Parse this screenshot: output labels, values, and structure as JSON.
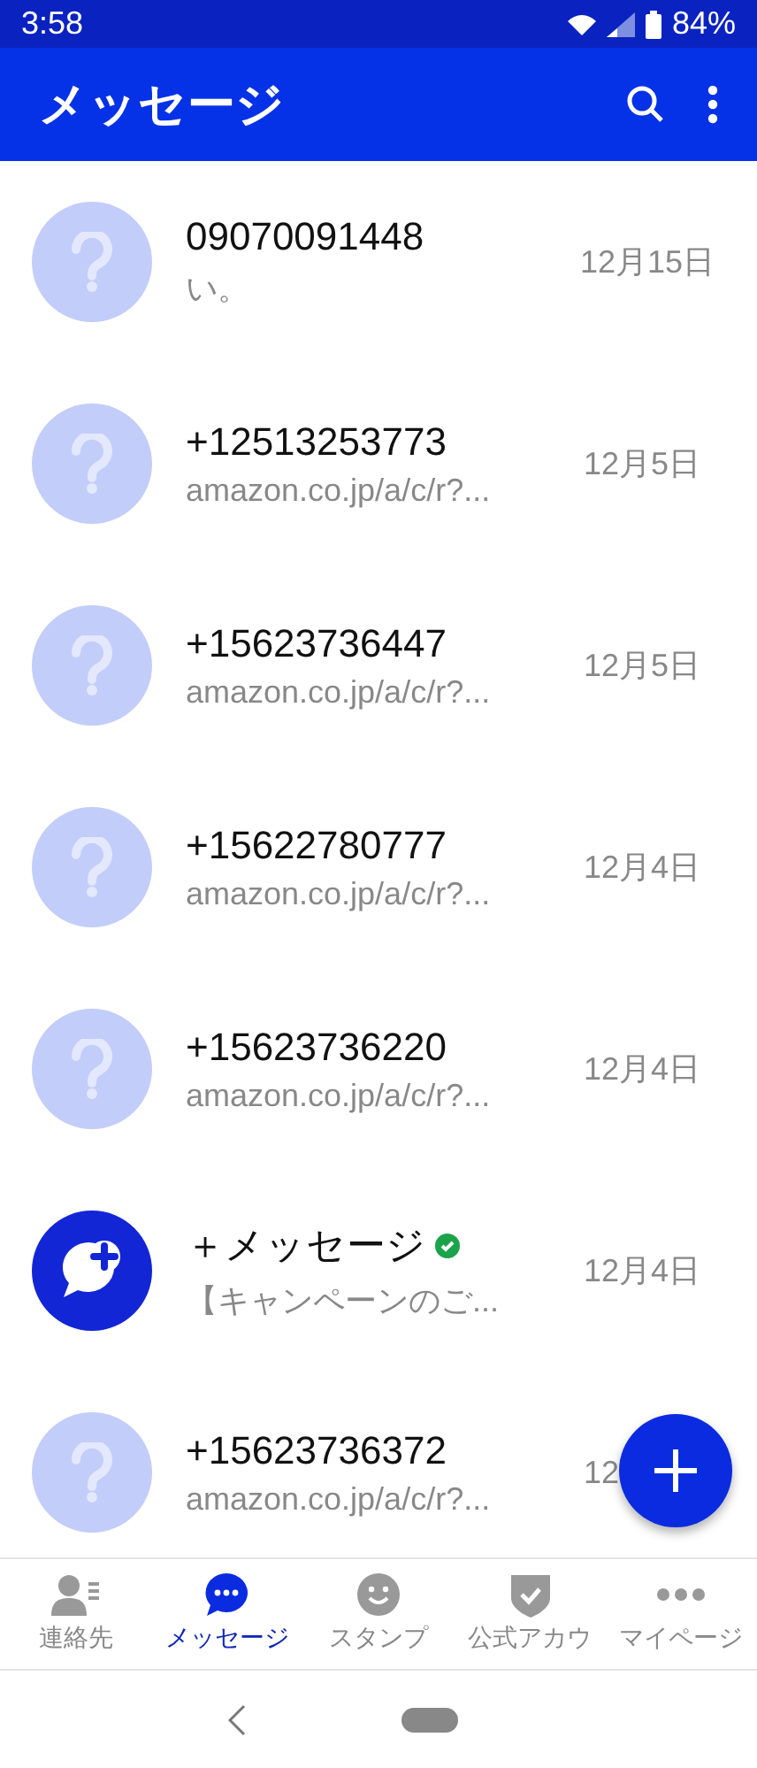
{
  "status_bar": {
    "time": "3:58",
    "battery": "84%"
  },
  "app_bar": {
    "title": "メッセージ"
  },
  "conversations": [
    {
      "kind": "unknown",
      "name": "09070091448",
      "preview": "い。",
      "date": "12月15日",
      "verified": false
    },
    {
      "kind": "unknown",
      "name": "+12513253773",
      "preview": "amazon.co.jp/a/c/r?...",
      "date": "12月5日",
      "verified": false
    },
    {
      "kind": "unknown",
      "name": "+15623736447",
      "preview": "amazon.co.jp/a/c/r?...",
      "date": "12月5日",
      "verified": false
    },
    {
      "kind": "unknown",
      "name": "+15622780777",
      "preview": "amazon.co.jp/a/c/r?...",
      "date": "12月4日",
      "verified": false
    },
    {
      "kind": "unknown",
      "name": "+15623736220",
      "preview": "amazon.co.jp/a/c/r?...",
      "date": "12月4日",
      "verified": false
    },
    {
      "kind": "brand",
      "name": "＋メッセージ",
      "preview": "【キャンペーンのご...",
      "date": "12月4日",
      "verified": true
    },
    {
      "kind": "unknown",
      "name": "+15623736372",
      "preview": "amazon.co.jp/a/c/r?...",
      "date": "12",
      "verified": false
    }
  ],
  "bottom_nav": [
    {
      "kind": "contacts",
      "label": "連絡先",
      "selected": false
    },
    {
      "kind": "messages",
      "label": "メッセージ",
      "selected": true
    },
    {
      "kind": "stamps",
      "label": "スタンプ",
      "selected": false
    },
    {
      "kind": "official",
      "label": "公式アカウ",
      "selected": false
    },
    {
      "kind": "mypage",
      "label": "マイページ",
      "selected": false
    }
  ]
}
